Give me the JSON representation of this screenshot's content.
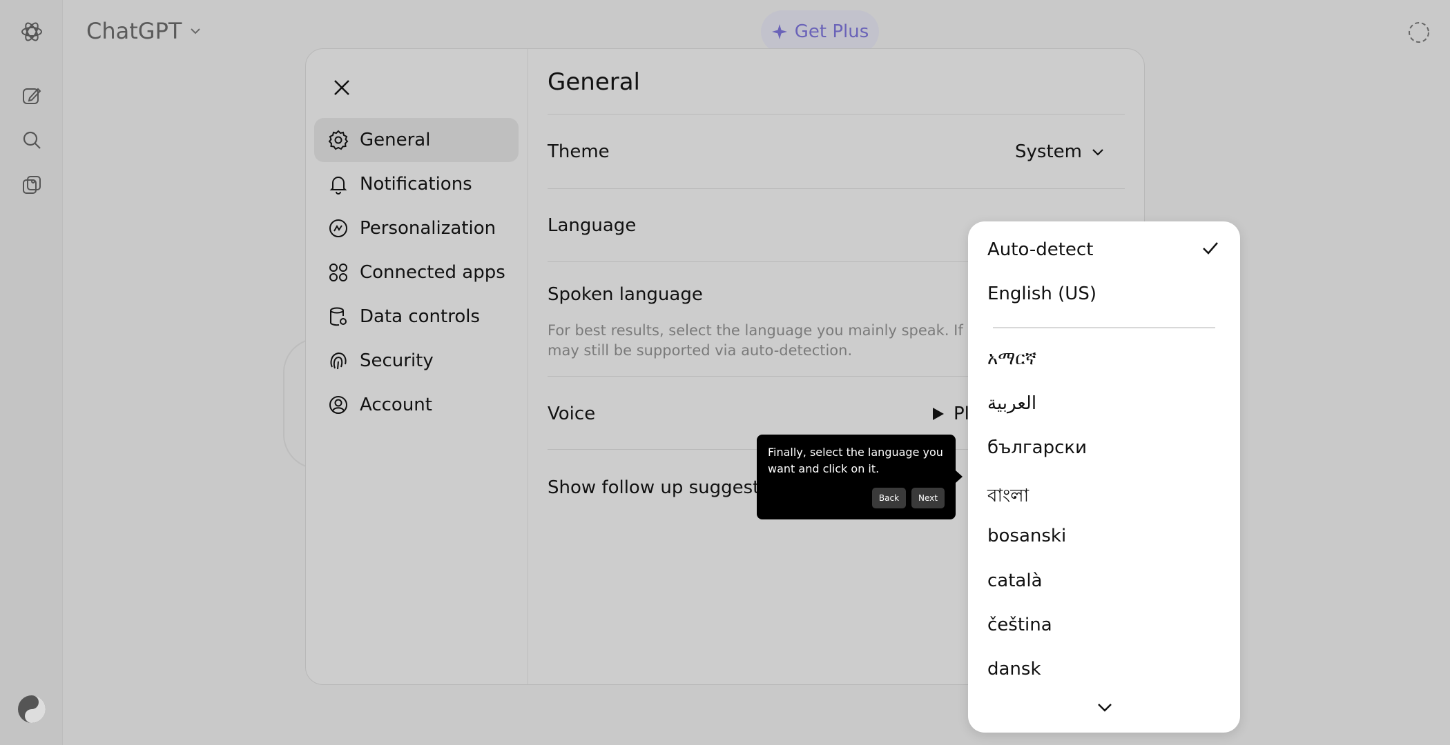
{
  "header": {
    "app_title": "ChatGPT",
    "get_plus": "Get Plus"
  },
  "settings": {
    "nav": [
      {
        "id": "general",
        "label": "General",
        "icon": "gear-icon"
      },
      {
        "id": "notifications",
        "label": "Notifications",
        "icon": "bell-icon"
      },
      {
        "id": "personalization",
        "label": "Personalization",
        "icon": "personalization-icon"
      },
      {
        "id": "connected-apps",
        "label": "Connected apps",
        "icon": "apps-icon"
      },
      {
        "id": "data-controls",
        "label": "Data controls",
        "icon": "database-icon"
      },
      {
        "id": "security",
        "label": "Security",
        "icon": "fingerprint-icon"
      },
      {
        "id": "account",
        "label": "Account",
        "icon": "user-circle-icon"
      }
    ],
    "title": "General",
    "theme": {
      "label": "Theme",
      "value": "System"
    },
    "language": {
      "label": "Language"
    },
    "spoken_language": {
      "label": "Spoken language",
      "hint_line1": "For best results, select the language you mainly speak. If it's",
      "hint_line2": "may still be supported via auto-detection."
    },
    "voice": {
      "label": "Voice",
      "play_label": "Pl"
    },
    "follow_up": {
      "label": "Show follow up suggestion"
    }
  },
  "tooltip": {
    "text_line1": "Finally, select the language you",
    "text_line2": "want and click on it.",
    "back": "Back",
    "next": "Next"
  },
  "language_dropdown": {
    "selected": "Auto-detect",
    "options": [
      "Auto-detect",
      "English (US)",
      "አማርኛ",
      "العربية",
      "български",
      "বাংলা",
      "bosanski",
      "català",
      "čeština",
      "dansk"
    ]
  },
  "colors": {
    "accent": "#6a63b8",
    "tooltip_bg": "#000000"
  }
}
